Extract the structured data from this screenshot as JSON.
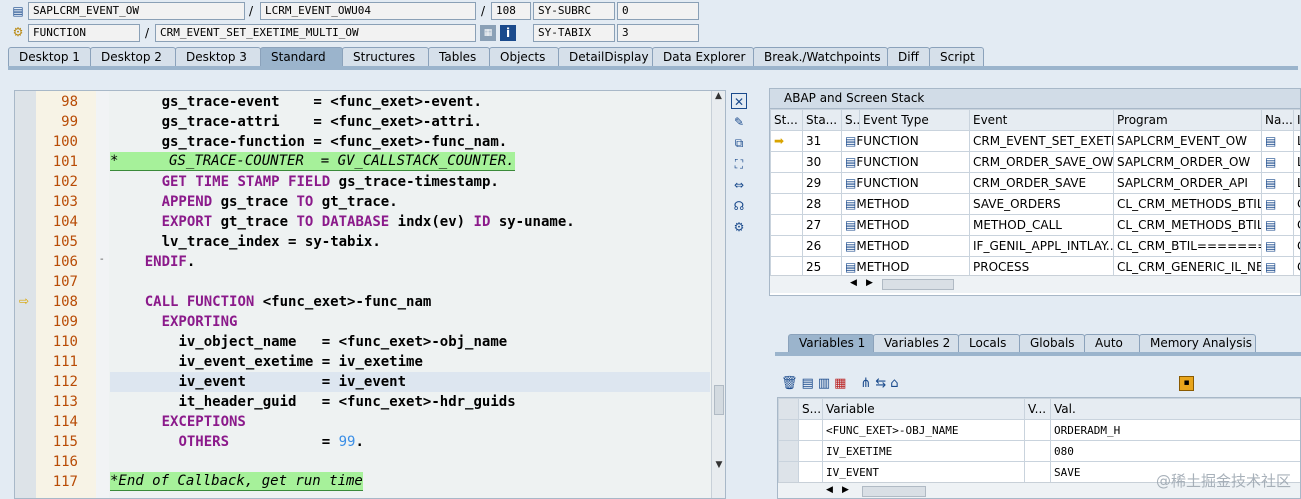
{
  "header": {
    "row1": {
      "program": "SAPLCRM_EVENT_OW",
      "include": "LCRM_EVENT_OWU04",
      "line": "108",
      "sysvar": "SY-SUBRC",
      "sysval": "0"
    },
    "row2": {
      "type": "FUNCTION",
      "name": "CRM_EVENT_SET_EXETIME_MULTI_OW",
      "sysvar": "SY-TABIX",
      "sysval": "3"
    },
    "sep": "/"
  },
  "tabs": [
    "Desktop 1",
    "Desktop 2",
    "Desktop 3",
    "Standard",
    "Structures",
    "Tables",
    "Objects",
    "DetailDisplay",
    "Data Explorer",
    "Break./Watchpoints",
    "Diff",
    "Script"
  ],
  "code": {
    "lines": [
      {
        "n": "98",
        "t": "      gs_trace-event    = <func_exet>-event."
      },
      {
        "n": "99",
        "t": "      gs_trace-attri    = <func_exet>-attri."
      },
      {
        "n": "100",
        "t": "      gs_trace-function = <func_exet>-func_nam."
      },
      {
        "n": "101",
        "t": "*      GS_TRACE-COUNTER  = GV_CALLSTACK_COUNTER."
      },
      {
        "n": "102",
        "t": "      GET TIME STAMP FIELD gs_trace-timestamp."
      },
      {
        "n": "103",
        "t": "      APPEND gs_trace TO gt_trace."
      },
      {
        "n": "104",
        "t": "      EXPORT gt_trace TO DATABASE indx(ev) ID sy-uname."
      },
      {
        "n": "105",
        "t": "      lv_trace_index = sy-tabix."
      },
      {
        "n": "106",
        "t": "    ENDIF."
      },
      {
        "n": "107",
        "t": ""
      },
      {
        "n": "108",
        "t": "    CALL FUNCTION <func_exet>-func_nam"
      },
      {
        "n": "109",
        "t": "      EXPORTING"
      },
      {
        "n": "110",
        "t": "        iv_object_name   = <func_exet>-obj_name"
      },
      {
        "n": "111",
        "t": "        iv_event_exetime = iv_exetime"
      },
      {
        "n": "112",
        "t": "        iv_event         = iv_event"
      },
      {
        "n": "113",
        "t": "        it_header_guid   = <func_exet>-hdr_guids"
      },
      {
        "n": "114",
        "t": "      EXCEPTIONS"
      },
      {
        "n": "115",
        "t": "        OTHERS           = 99."
      },
      {
        "n": "116",
        "t": ""
      },
      {
        "n": "117",
        "t": "*End of Callback, get run time"
      }
    ]
  },
  "stack": {
    "title": "ABAP and Screen Stack",
    "cols": [
      "St...",
      "Sta...",
      "S...",
      "Event Type",
      "Event",
      "Program",
      "Na...",
      "I"
    ],
    "rows": [
      {
        "level": "31",
        "type": "FUNCTION",
        "event": "CRM_EVENT_SET_EXETI...",
        "program": "SAPLCRM_EVENT_OW",
        "i": "L"
      },
      {
        "level": "30",
        "type": "FUNCTION",
        "event": "CRM_ORDER_SAVE_OW",
        "program": "SAPLCRM_ORDER_OW",
        "i": "L"
      },
      {
        "level": "29",
        "type": "FUNCTION",
        "event": "CRM_ORDER_SAVE",
        "program": "SAPLCRM_ORDER_API",
        "i": "L"
      },
      {
        "level": "28",
        "type": "METHOD",
        "event": "SAVE_ORDERS",
        "program": "CL_CRM_METHODS_BTIL...",
        "i": "C"
      },
      {
        "level": "27",
        "type": "METHOD",
        "event": "METHOD_CALL",
        "program": "CL_CRM_METHODS_BTIL...",
        "i": "C"
      },
      {
        "level": "26",
        "type": "METHOD",
        "event": "IF_GENIL_APPL_INTLAY...",
        "program": "CL_CRM_BTIL========...",
        "i": "C"
      },
      {
        "level": "25",
        "type": "METHOD",
        "event": "PROCESS",
        "program": "CL_CRM_GENERIC_IL_NE...",
        "i": "C"
      }
    ]
  },
  "vtabs": [
    "Variables 1",
    "Variables 2",
    "Locals",
    "Globals",
    "Auto",
    "Memory Analysis"
  ],
  "vars": {
    "cols": [
      "S...",
      "Variable",
      "V...",
      "Val."
    ],
    "rows": [
      {
        "name": "<FUNC_EXET>-OBJ_NAME",
        "val": "ORDERADM_H"
      },
      {
        "name": "IV_EXETIME",
        "val": "080"
      },
      {
        "name": "IV_EVENT",
        "val": "SAVE"
      }
    ]
  },
  "watermark": "@稀土掘金技术社区"
}
